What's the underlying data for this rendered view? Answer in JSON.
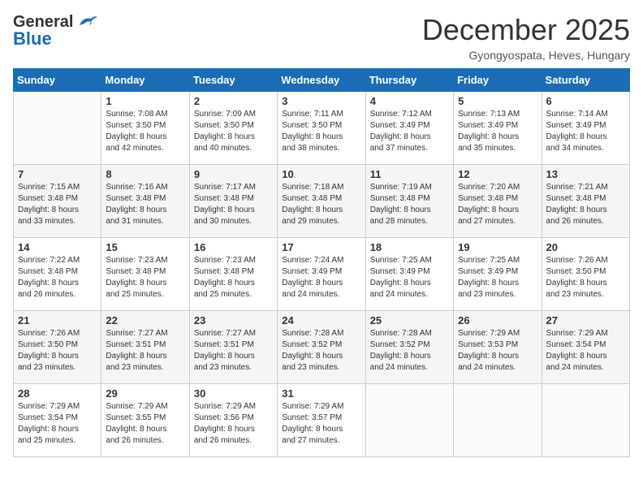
{
  "header": {
    "logo_general": "General",
    "logo_blue": "Blue",
    "month_title": "December 2025",
    "location": "Gyongyospata, Heves, Hungary"
  },
  "weekdays": [
    "Sunday",
    "Monday",
    "Tuesday",
    "Wednesday",
    "Thursday",
    "Friday",
    "Saturday"
  ],
  "weeks": [
    [
      {
        "day": "",
        "sunrise": "",
        "sunset": "",
        "daylight": ""
      },
      {
        "day": "1",
        "sunrise": "Sunrise: 7:08 AM",
        "sunset": "Sunset: 3:50 PM",
        "daylight": "Daylight: 8 hours and 42 minutes."
      },
      {
        "day": "2",
        "sunrise": "Sunrise: 7:09 AM",
        "sunset": "Sunset: 3:50 PM",
        "daylight": "Daylight: 8 hours and 40 minutes."
      },
      {
        "day": "3",
        "sunrise": "Sunrise: 7:11 AM",
        "sunset": "Sunset: 3:50 PM",
        "daylight": "Daylight: 8 hours and 38 minutes."
      },
      {
        "day": "4",
        "sunrise": "Sunrise: 7:12 AM",
        "sunset": "Sunset: 3:49 PM",
        "daylight": "Daylight: 8 hours and 37 minutes."
      },
      {
        "day": "5",
        "sunrise": "Sunrise: 7:13 AM",
        "sunset": "Sunset: 3:49 PM",
        "daylight": "Daylight: 8 hours and 35 minutes."
      },
      {
        "day": "6",
        "sunrise": "Sunrise: 7:14 AM",
        "sunset": "Sunset: 3:49 PM",
        "daylight": "Daylight: 8 hours and 34 minutes."
      }
    ],
    [
      {
        "day": "7",
        "sunrise": "Sunrise: 7:15 AM",
        "sunset": "Sunset: 3:48 PM",
        "daylight": "Daylight: 8 hours and 33 minutes."
      },
      {
        "day": "8",
        "sunrise": "Sunrise: 7:16 AM",
        "sunset": "Sunset: 3:48 PM",
        "daylight": "Daylight: 8 hours and 31 minutes."
      },
      {
        "day": "9",
        "sunrise": "Sunrise: 7:17 AM",
        "sunset": "Sunset: 3:48 PM",
        "daylight": "Daylight: 8 hours and 30 minutes."
      },
      {
        "day": "10",
        "sunrise": "Sunrise: 7:18 AM",
        "sunset": "Sunset: 3:48 PM",
        "daylight": "Daylight: 8 hours and 29 minutes."
      },
      {
        "day": "11",
        "sunrise": "Sunrise: 7:19 AM",
        "sunset": "Sunset: 3:48 PM",
        "daylight": "Daylight: 8 hours and 28 minutes."
      },
      {
        "day": "12",
        "sunrise": "Sunrise: 7:20 AM",
        "sunset": "Sunset: 3:48 PM",
        "daylight": "Daylight: 8 hours and 27 minutes."
      },
      {
        "day": "13",
        "sunrise": "Sunrise: 7:21 AM",
        "sunset": "Sunset: 3:48 PM",
        "daylight": "Daylight: 8 hours and 26 minutes."
      }
    ],
    [
      {
        "day": "14",
        "sunrise": "Sunrise: 7:22 AM",
        "sunset": "Sunset: 3:48 PM",
        "daylight": "Daylight: 8 hours and 26 minutes."
      },
      {
        "day": "15",
        "sunrise": "Sunrise: 7:23 AM",
        "sunset": "Sunset: 3:48 PM",
        "daylight": "Daylight: 8 hours and 25 minutes."
      },
      {
        "day": "16",
        "sunrise": "Sunrise: 7:23 AM",
        "sunset": "Sunset: 3:48 PM",
        "daylight": "Daylight: 8 hours and 25 minutes."
      },
      {
        "day": "17",
        "sunrise": "Sunrise: 7:24 AM",
        "sunset": "Sunset: 3:49 PM",
        "daylight": "Daylight: 8 hours and 24 minutes."
      },
      {
        "day": "18",
        "sunrise": "Sunrise: 7:25 AM",
        "sunset": "Sunset: 3:49 PM",
        "daylight": "Daylight: 8 hours and 24 minutes."
      },
      {
        "day": "19",
        "sunrise": "Sunrise: 7:25 AM",
        "sunset": "Sunset: 3:49 PM",
        "daylight": "Daylight: 8 hours and 23 minutes."
      },
      {
        "day": "20",
        "sunrise": "Sunrise: 7:26 AM",
        "sunset": "Sunset: 3:50 PM",
        "daylight": "Daylight: 8 hours and 23 minutes."
      }
    ],
    [
      {
        "day": "21",
        "sunrise": "Sunrise: 7:26 AM",
        "sunset": "Sunset: 3:50 PM",
        "daylight": "Daylight: 8 hours and 23 minutes."
      },
      {
        "day": "22",
        "sunrise": "Sunrise: 7:27 AM",
        "sunset": "Sunset: 3:51 PM",
        "daylight": "Daylight: 8 hours and 23 minutes."
      },
      {
        "day": "23",
        "sunrise": "Sunrise: 7:27 AM",
        "sunset": "Sunset: 3:51 PM",
        "daylight": "Daylight: 8 hours and 23 minutes."
      },
      {
        "day": "24",
        "sunrise": "Sunrise: 7:28 AM",
        "sunset": "Sunset: 3:52 PM",
        "daylight": "Daylight: 8 hours and 23 minutes."
      },
      {
        "day": "25",
        "sunrise": "Sunrise: 7:28 AM",
        "sunset": "Sunset: 3:52 PM",
        "daylight": "Daylight: 8 hours and 24 minutes."
      },
      {
        "day": "26",
        "sunrise": "Sunrise: 7:29 AM",
        "sunset": "Sunset: 3:53 PM",
        "daylight": "Daylight: 8 hours and 24 minutes."
      },
      {
        "day": "27",
        "sunrise": "Sunrise: 7:29 AM",
        "sunset": "Sunset: 3:54 PM",
        "daylight": "Daylight: 8 hours and 24 minutes."
      }
    ],
    [
      {
        "day": "28",
        "sunrise": "Sunrise: 7:29 AM",
        "sunset": "Sunset: 3:54 PM",
        "daylight": "Daylight: 8 hours and 25 minutes."
      },
      {
        "day": "29",
        "sunrise": "Sunrise: 7:29 AM",
        "sunset": "Sunset: 3:55 PM",
        "daylight": "Daylight: 8 hours and 26 minutes."
      },
      {
        "day": "30",
        "sunrise": "Sunrise: 7:29 AM",
        "sunset": "Sunset: 3:56 PM",
        "daylight": "Daylight: 8 hours and 26 minutes."
      },
      {
        "day": "31",
        "sunrise": "Sunrise: 7:29 AM",
        "sunset": "Sunset: 3:57 PM",
        "daylight": "Daylight: 8 hours and 27 minutes."
      },
      {
        "day": "",
        "sunrise": "",
        "sunset": "",
        "daylight": ""
      },
      {
        "day": "",
        "sunrise": "",
        "sunset": "",
        "daylight": ""
      },
      {
        "day": "",
        "sunrise": "",
        "sunset": "",
        "daylight": ""
      }
    ]
  ]
}
